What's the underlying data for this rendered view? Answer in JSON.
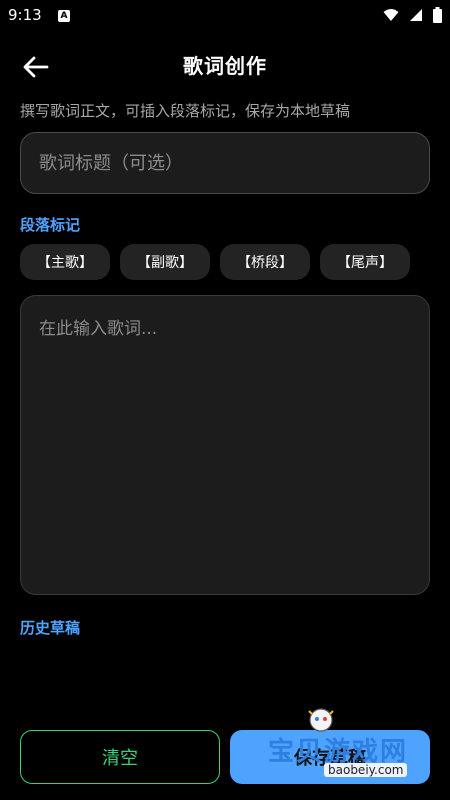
{
  "status_bar": {
    "time": "9:13",
    "notification_letter": "A",
    "icons": [
      "wifi-icon",
      "signal-icon",
      "battery-icon"
    ]
  },
  "header": {
    "title": "歌词创作",
    "back_icon": "arrow-left-icon"
  },
  "subtitle": "撰写歌词正文，可插入段落标记，保存为本地草稿",
  "title_input": {
    "placeholder": "歌词标题（可选）",
    "value": ""
  },
  "section_markers": {
    "label": "段落标记",
    "chips": [
      "【主歌】",
      "【副歌】",
      "【桥段】",
      "【尾声】"
    ]
  },
  "lyrics_input": {
    "placeholder": "在此输入歌词...",
    "value": ""
  },
  "drafts": {
    "label": "历史草稿"
  },
  "actions": {
    "clear_label": "清空",
    "save_label": "保存草稿"
  },
  "watermark": {
    "text": "宝贝游戏网",
    "url": "baobeiy.com"
  },
  "colors": {
    "accent_blue": "#4ea3ff",
    "accent_green": "#39d27a",
    "background": "#000000",
    "field": "#1c1c1c"
  }
}
